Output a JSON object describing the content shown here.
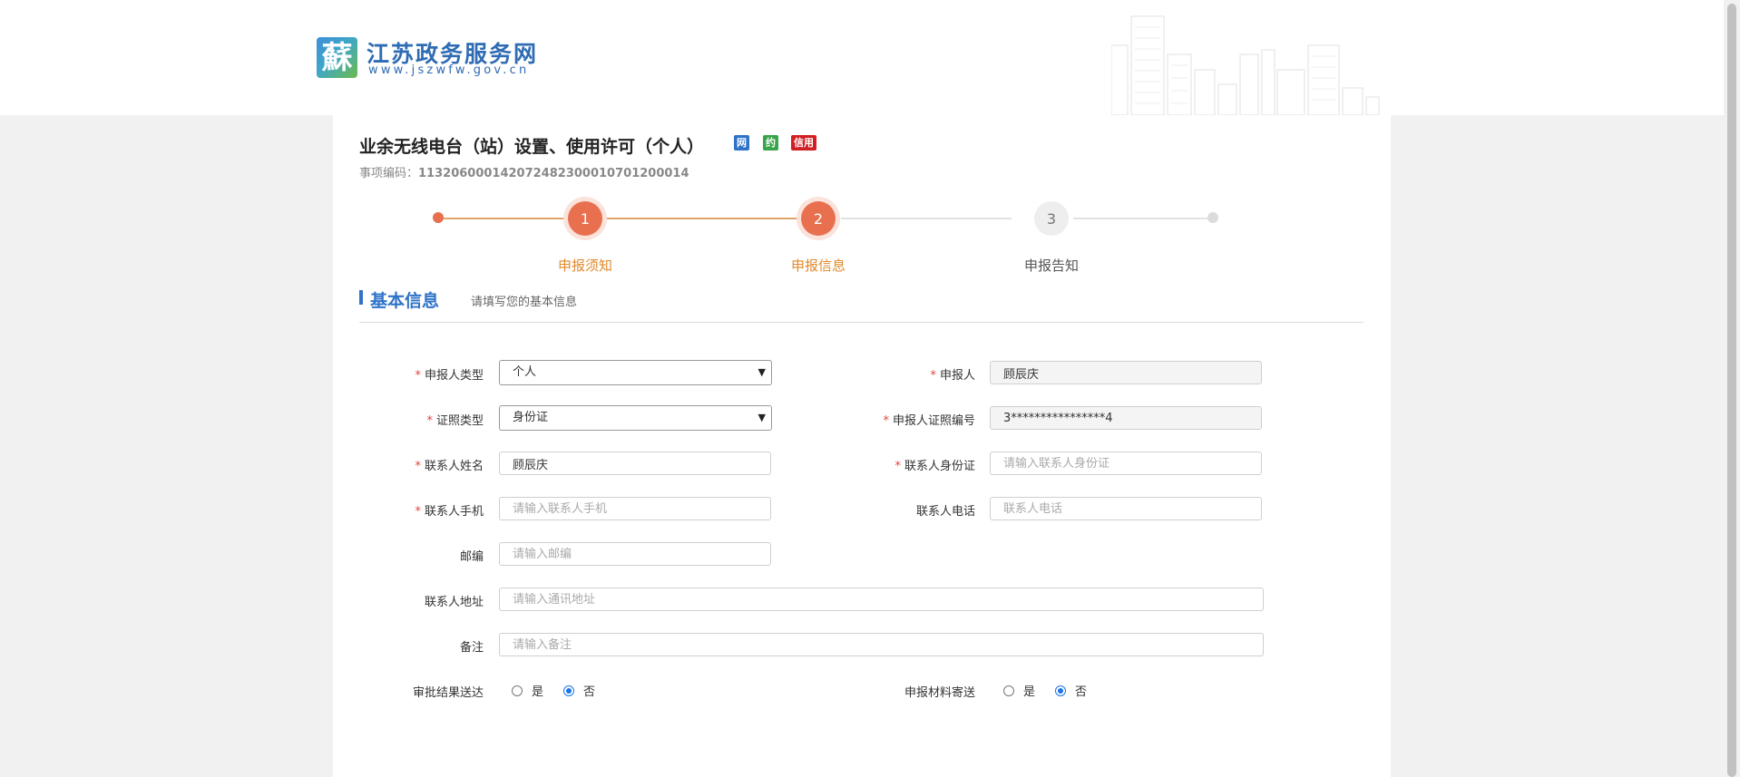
{
  "header": {
    "logo_glyph": "蘇",
    "site_title": "江苏政务服务网",
    "site_url": "www.jszwfw.gov.cn"
  },
  "item": {
    "title": "业余无线电台（站）设置、使用许可（个人）",
    "badges": [
      "网",
      "约",
      "信用"
    ],
    "code_label": "事项编码：",
    "code_value": "11320600014207248230001070120001​4"
  },
  "steps": [
    {
      "number": "1",
      "label": "申报须知",
      "state": "done"
    },
    {
      "number": "2",
      "label": "申报信息",
      "state": "active"
    },
    {
      "number": "3",
      "label": "申报告知",
      "state": "todo"
    }
  ],
  "section": {
    "title": "基本信息",
    "subtitle": "请填写您的基本信息"
  },
  "form": {
    "applicant_type": {
      "label": "申报人类型",
      "required": true,
      "value": "个人"
    },
    "applicant": {
      "label": "申报人",
      "required": true,
      "value": "顾辰庆"
    },
    "cert_type": {
      "label": "证照类型",
      "required": true,
      "value": "身份证"
    },
    "cert_number": {
      "label": "申报人证照编号",
      "required": true,
      "value": "3****************4"
    },
    "contact_name": {
      "label": "联系人姓名",
      "required": true,
      "value": "顾辰庆"
    },
    "contact_id": {
      "label": "联系人身份证",
      "required": true,
      "placeholder": "请输入联系人身份证"
    },
    "contact_mobile": {
      "label": "联系人手机",
      "required": true,
      "placeholder": "请输入联系人手机"
    },
    "contact_phone": {
      "label": "联系人电话",
      "required": false,
      "placeholder": "联系人电话"
    },
    "postcode": {
      "label": "邮编",
      "required": false,
      "placeholder": "请输入邮编"
    },
    "contact_address": {
      "label": "联系人地址",
      "required": false,
      "placeholder": "请输入通讯地址"
    },
    "remark": {
      "label": "备注",
      "required": false,
      "placeholder": "请输入备注"
    },
    "result_delivery": {
      "label": "审批结果送达",
      "yes": "是",
      "no": "否",
      "selected": "否"
    },
    "material_mail": {
      "label": "申报材料寄送",
      "yes": "是",
      "no": "否",
      "selected": "否"
    }
  },
  "colors": {
    "brand_blue": "#2f73c9",
    "step_orange": "#e8704f",
    "step_label_orange": "#e08a2c",
    "required_red": "#e5433b"
  }
}
